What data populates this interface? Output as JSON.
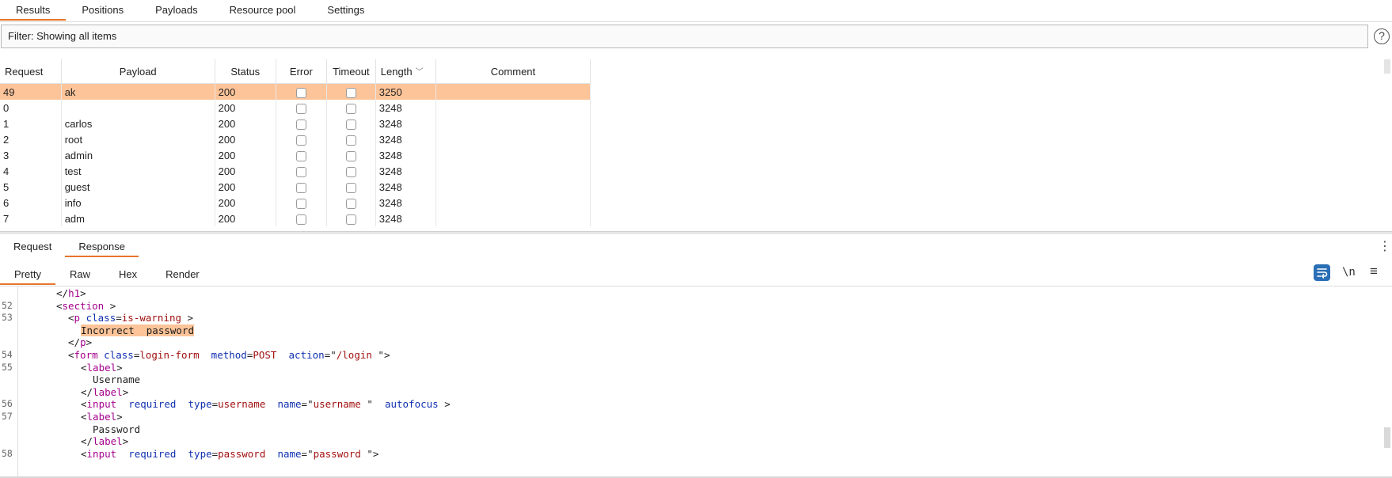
{
  "top_tabs": [
    "Results",
    "Positions",
    "Payloads",
    "Resource pool",
    "Settings"
  ],
  "filter": {
    "text": "Filter: Showing all items"
  },
  "help_icon": "?",
  "table": {
    "columns": [
      "Request",
      "Payload",
      "Status",
      "Error",
      "Timeout",
      "Length",
      "Comment"
    ],
    "sorted_column": "Length",
    "rows": [
      {
        "request": "49",
        "payload": "ak",
        "status": "200",
        "length": "3250",
        "selected": true
      },
      {
        "request": "0",
        "payload": "",
        "status": "200",
        "length": "3248"
      },
      {
        "request": "1",
        "payload": "carlos",
        "status": "200",
        "length": "3248"
      },
      {
        "request": "2",
        "payload": "root",
        "status": "200",
        "length": "3248"
      },
      {
        "request": "3",
        "payload": "admin",
        "status": "200",
        "length": "3248"
      },
      {
        "request": "4",
        "payload": "test",
        "status": "200",
        "length": "3248"
      },
      {
        "request": "5",
        "payload": "guest",
        "status": "200",
        "length": "3248"
      },
      {
        "request": "6",
        "payload": "info",
        "status": "200",
        "length": "3248"
      },
      {
        "request": "7",
        "payload": "adm",
        "status": "200",
        "length": "3248"
      }
    ]
  },
  "rr_tabs": [
    "Request",
    "Response"
  ],
  "view_tabs": [
    "Pretty",
    "Raw",
    "Hex",
    "Render"
  ],
  "icons": {
    "wrap": "wrap-icon",
    "newline": "\\n",
    "options": "≡",
    "more": "⋮"
  },
  "code_lines": [
    {
      "num": "",
      "tokens": [
        [
          "pn",
          "</"
        ],
        [
          "tg",
          "h1"
        ],
        [
          "pn",
          ">"
        ]
      ],
      "indent": 0
    },
    {
      "num": "52",
      "tokens": [
        [
          "pn",
          "<"
        ],
        [
          "tg",
          "section"
        ],
        [
          "pn",
          " >"
        ]
      ],
      "indent": 0
    },
    {
      "num": "53",
      "tokens": [
        [
          "pn",
          "<"
        ],
        [
          "tg",
          "p"
        ],
        [
          "pn",
          " "
        ],
        [
          "at",
          "class"
        ],
        [
          "pn",
          "="
        ],
        [
          "vl",
          "is-warning"
        ],
        [
          "pn",
          " >"
        ]
      ],
      "indent": 1
    },
    {
      "num": "",
      "tokens": [
        [
          "hl",
          "Incorrect  password"
        ]
      ],
      "indent": 2
    },
    {
      "num": "",
      "tokens": [
        [
          "pn",
          "</"
        ],
        [
          "tg",
          "p"
        ],
        [
          "pn",
          ">"
        ]
      ],
      "indent": 1
    },
    {
      "num": "54",
      "tokens": [
        [
          "pn",
          "<"
        ],
        [
          "tg",
          "form"
        ],
        [
          "pn",
          " "
        ],
        [
          "at",
          "class"
        ],
        [
          "pn",
          "="
        ],
        [
          "vl",
          "login-form"
        ],
        [
          "pn",
          "  "
        ],
        [
          "at",
          "method"
        ],
        [
          "pn",
          "="
        ],
        [
          "vl",
          "POST"
        ],
        [
          "pn",
          "  "
        ],
        [
          "at",
          "action"
        ],
        [
          "pn",
          "=\""
        ],
        [
          "vl",
          "/login"
        ],
        [
          "pn",
          " \">"
        ]
      ],
      "indent": 1
    },
    {
      "num": "55",
      "tokens": [
        [
          "pn",
          "<"
        ],
        [
          "tg",
          "label"
        ],
        [
          "pn",
          ">"
        ]
      ],
      "indent": 2
    },
    {
      "num": "",
      "tokens": [
        [
          "pn",
          "Username"
        ]
      ],
      "indent": 3
    },
    {
      "num": "",
      "tokens": [
        [
          "pn",
          "</"
        ],
        [
          "tg",
          "label"
        ],
        [
          "pn",
          ">"
        ]
      ],
      "indent": 2
    },
    {
      "num": "56",
      "tokens": [
        [
          "pn",
          "<"
        ],
        [
          "tg",
          "input"
        ],
        [
          "pn",
          "  "
        ],
        [
          "at",
          "required"
        ],
        [
          "pn",
          "  "
        ],
        [
          "at",
          "type"
        ],
        [
          "pn",
          "="
        ],
        [
          "vl",
          "username"
        ],
        [
          "pn",
          "  "
        ],
        [
          "at",
          "name"
        ],
        [
          "pn",
          "=\""
        ],
        [
          "vl",
          "username"
        ],
        [
          "pn",
          " \"  "
        ],
        [
          "at",
          "autofocus"
        ],
        [
          "pn",
          " >"
        ]
      ],
      "indent": 2
    },
    {
      "num": "57",
      "tokens": [
        [
          "pn",
          "<"
        ],
        [
          "tg",
          "label"
        ],
        [
          "pn",
          ">"
        ]
      ],
      "indent": 2
    },
    {
      "num": "",
      "tokens": [
        [
          "pn",
          "Password"
        ]
      ],
      "indent": 3
    },
    {
      "num": "",
      "tokens": [
        [
          "pn",
          "</"
        ],
        [
          "tg",
          "label"
        ],
        [
          "pn",
          ">"
        ]
      ],
      "indent": 2
    },
    {
      "num": "58",
      "tokens": [
        [
          "pn",
          "<"
        ],
        [
          "tg",
          "input"
        ],
        [
          "pn",
          "  "
        ],
        [
          "at",
          "required"
        ],
        [
          "pn",
          "  "
        ],
        [
          "at",
          "type"
        ],
        [
          "pn",
          "="
        ],
        [
          "vl",
          "password"
        ],
        [
          "pn",
          "  "
        ],
        [
          "at",
          "name"
        ],
        [
          "pn",
          "=\""
        ],
        [
          "vl",
          "password"
        ],
        [
          "pn",
          " \">"
        ]
      ],
      "indent": 2
    }
  ]
}
